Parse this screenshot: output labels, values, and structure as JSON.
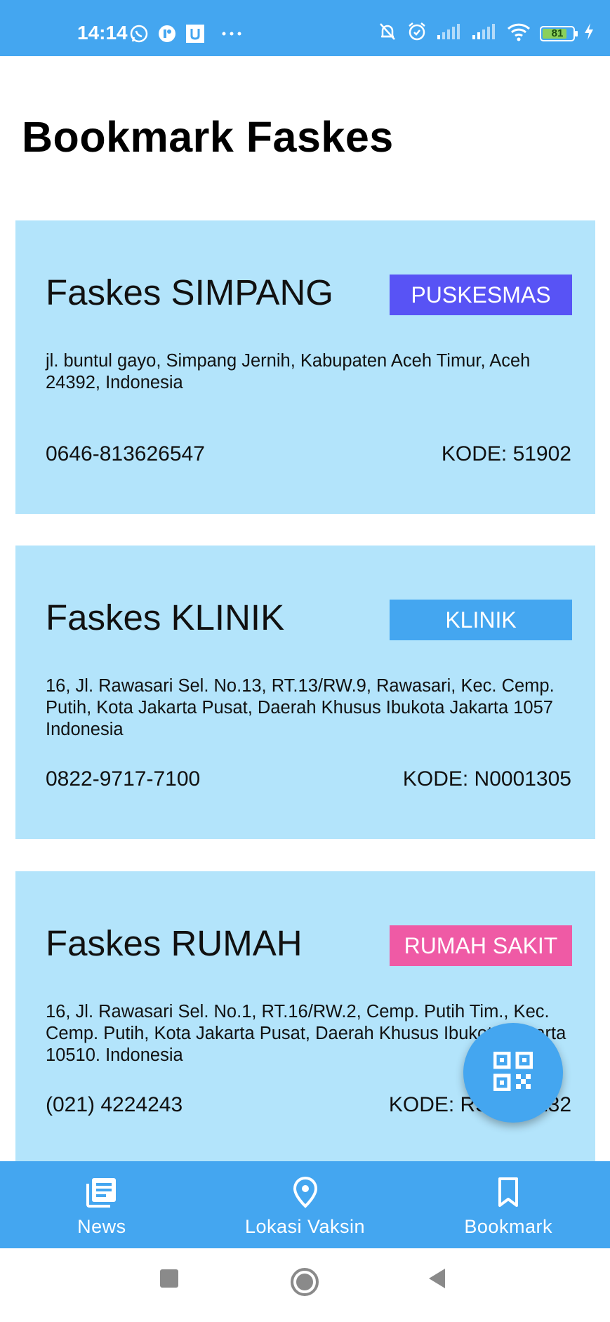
{
  "status_bar": {
    "time": "14:14",
    "battery_level": "81",
    "battery_fraction": 0.81,
    "icons": [
      "whatsapp-icon",
      "messenger-icon",
      "app-u-icon",
      "more-dots-icon",
      "notifications-muted-icon",
      "alarm-icon",
      "signal-icon",
      "signal-icon",
      "wifi-icon",
      "battery-icon",
      "charging-icon"
    ],
    "color": "#44a6f0"
  },
  "page": {
    "title": "Bookmark Faskes"
  },
  "cards": [
    {
      "name": "Faskes SIMPANG",
      "type": "PUSKESMAS",
      "badge_color": "#5853f5",
      "address": "jl. buntul gayo, Simpang Jernih, Kabupaten Aceh Timur, Aceh 24392, Indonesia",
      "phone": "0646-813626547",
      "code": "KODE: 51902"
    },
    {
      "name": "Faskes KLINIK",
      "type": "KLINIK",
      "badge_color": "#44a6f0",
      "address": "16, Jl. Rawasari Sel. No.13, RT.13/RW.9, Rawasari, Kec. Cemp. Putih, Kota Jakarta Pusat, Daerah Khusus Ibukota Jakarta 1057 Indonesia",
      "phone": "0822-9717-7100",
      "code": "KODE: N0001305"
    },
    {
      "name": "Faskes RUMAH",
      "type": "RUMAH SAKIT",
      "badge_color": "#ef5aa5",
      "address": "16, Jl. Rawasari Sel. No.1, RT.16/RW.2, Cemp. Putih Tim., Kec. Cemp. Putih, Kota Jakarta Pusat, Daerah Khusus Ibukota Jakarta 10510. Indonesia",
      "phone": "(021) 4224243",
      "code": "KODE: RS0001232"
    }
  ],
  "fab": {
    "icon": "qr-code-icon"
  },
  "bottom_nav": {
    "items": [
      {
        "label": "News",
        "icon": "news-icon"
      },
      {
        "label": "Lokasi Vaksin",
        "icon": "location-pin-icon"
      },
      {
        "label": "Bookmark",
        "icon": "bookmark-icon"
      }
    ],
    "active": "Bookmark"
  },
  "colors": {
    "primary": "#44a6f0",
    "card_background": "#b3e4fb"
  }
}
